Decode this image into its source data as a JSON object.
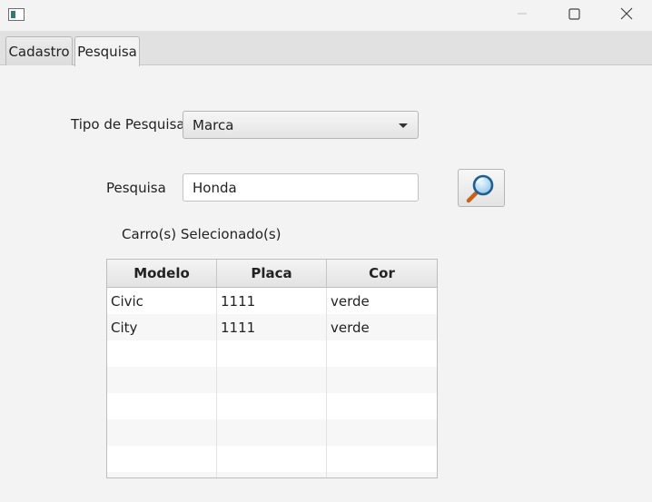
{
  "window": {
    "icons": {
      "app": "app-window-icon",
      "minimize": "minimize-icon",
      "maximize": "maximize-icon",
      "close": "close-icon"
    }
  },
  "tabs": [
    {
      "label": "Cadastro",
      "selected": false
    },
    {
      "label": "Pesquisa",
      "selected": true
    }
  ],
  "form": {
    "tipo_label": "Tipo de Pesquisa",
    "tipo_value": "Marca",
    "pesquisa_label": "Pesquisa",
    "pesquisa_value": "Honda",
    "search_icon": "magnifier-icon"
  },
  "results": {
    "caption": "Carro(s) Selecionado(s)",
    "columns": [
      "Modelo",
      "Placa",
      "Cor"
    ],
    "rows": [
      [
        "Civic",
        "1111",
        "verde"
      ],
      [
        "City",
        "1111",
        "verde"
      ]
    ]
  }
}
